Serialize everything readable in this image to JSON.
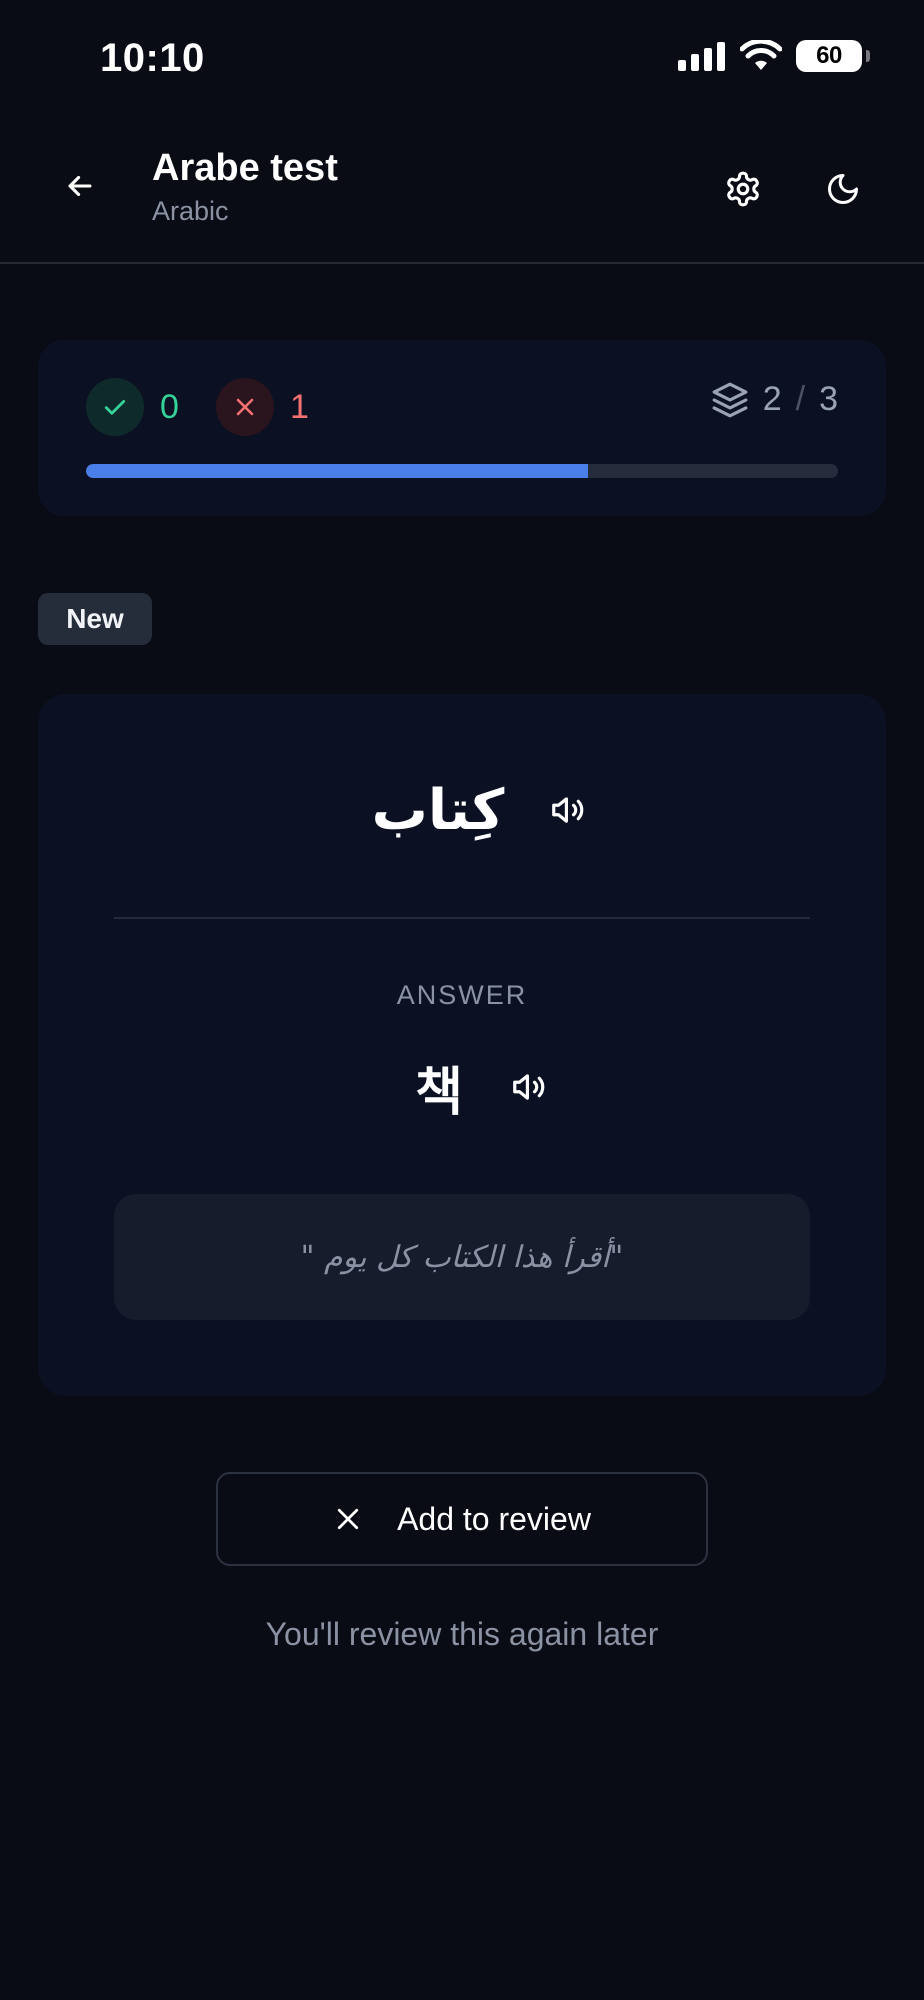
{
  "status_bar": {
    "time": "10:10",
    "battery": "60"
  },
  "header": {
    "title": "Arabe test",
    "subtitle": "Arabic",
    "back_icon": "arrow-left-icon",
    "settings_icon": "gear-icon",
    "theme_icon": "moon-icon"
  },
  "progress": {
    "correct_count": "0",
    "wrong_count": "1",
    "current_card": "2",
    "separator": "/",
    "total_cards": "3",
    "fraction_complete": 0.667,
    "correct_color": "#34d399",
    "wrong_color": "#f87171",
    "accent_color": "#4a7ee8"
  },
  "card": {
    "badge": "New",
    "question": "كِتاب",
    "answer_label": "ANSWER",
    "answer": "책",
    "example": "\"أقرأ هذا الكتاب كل يوم \""
  },
  "actions": {
    "add_to_review_label": "Add to review",
    "note": "You'll review this again later"
  }
}
